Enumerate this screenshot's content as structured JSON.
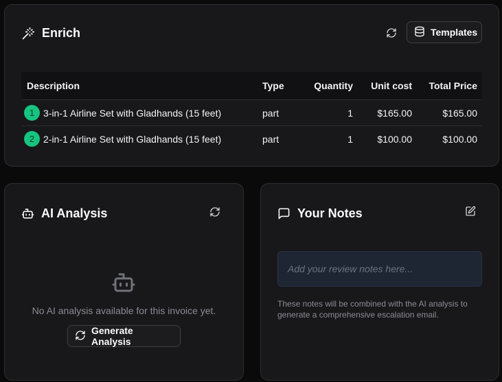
{
  "enrich": {
    "title": "Enrich",
    "templates_label": "Templates",
    "table": {
      "headers": [
        "Description",
        "Type",
        "Quantity",
        "Unit cost",
        "Total Price"
      ],
      "rows": [
        {
          "num": "1",
          "description": "3-in-1 Airline Set with Gladhands (15 feet)",
          "type": "part",
          "quantity": "1",
          "unit_cost": "$165.00",
          "total": "$165.00"
        },
        {
          "num": "2",
          "description": "2-in-1 Airline Set with Gladhands (15 feet)",
          "type": "part",
          "quantity": "1",
          "unit_cost": "$100.00",
          "total": "$100.00"
        }
      ]
    }
  },
  "ai_analysis": {
    "title": "AI Analysis",
    "empty_text": "No AI analysis available for this invoice yet.",
    "generate_label": "Generate Analysis"
  },
  "notes": {
    "title": "Your Notes",
    "placeholder": "Add your review notes here...",
    "help_text": "These notes will be combined with the AI analysis to generate a comprehensive escalation email."
  },
  "colors": {
    "background": "#0a0a0b",
    "card": "#18181b",
    "badge": "#16c47f",
    "notes_input": "#1f2633"
  },
  "icons": [
    "magic-wand-icon",
    "refresh-icon",
    "database-icon",
    "bot-icon",
    "message-square-icon",
    "edit-icon"
  ]
}
